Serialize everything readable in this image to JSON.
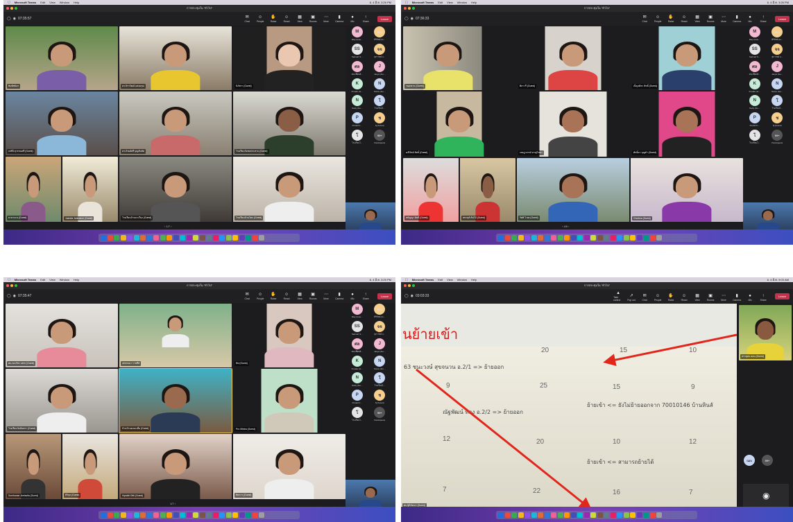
{
  "menubar": {
    "app": "Microsoft Teams",
    "items": [
      "Edit",
      "View",
      "Window",
      "Help"
    ]
  },
  "clocks": [
    "อ. 4 มี.ค. 3:26 PM",
    "อ. 4 มี.ค. 3:25 PM",
    "อ. 4 มี.ค. 9:03 AM"
  ],
  "meeting_title": "การประชุมใน \"ทั่วไป\"",
  "timers": [
    "07:35:57",
    "07:36:33",
    "07:35:47",
    "03:03:33"
  ],
  "toolbar": {
    "chat": "Chat",
    "people": "People",
    "raise": "Raise",
    "react": "React",
    "view": "View",
    "rooms": "Rooms",
    "more": "More",
    "camera": "Camera",
    "mic": "Mic",
    "share": "Share",
    "leave": "Leave",
    "take_control": "Take control",
    "pop_out": "Pop out"
  },
  "shot1": {
    "tiles": [
      "พิมพ์ชนิดา",
      "ดร.จิราวัฒน์ แสงอรุณ",
      "นิภัสรา (Guest)",
      "เกศินี สุวรรณศรี (Guest)",
      "ดร.ภิรมย์ศรี บุญสันทัด",
      "โรงเรียนวัดชลประทาน (Guest)",
      "ดาดาแกง (Guest)",
      "Juenda Juntraeon (Guest)",
      "โรงเรียนบ้านนาเวียง (Guest)",
      "โรงเรียนบ้านโคก (Guest)"
    ],
    "pager": "1/7"
  },
  "shot2": {
    "tiles": [
      "รณุกษาน (Guest)",
      "ศิลาวรี (Guest)",
      "เบ็ญจศิลา สิทธิ์ (Guest)",
      "มณีรัตน์ สิทธิ์ (Guest)",
      "เจษฎาภรณ์ หาญไชยา",
      "ศักดิ์ดา บุญคำ (Guest)",
      "สมัญญา อิทธิ์ (Guest)",
      "สหายุต์ ต้นไม้ (Guest)",
      "รัตติ ไวงย (Guest)",
      "Chutima (Guest)"
    ],
    "pager": "4/6"
  },
  "shot3": {
    "tiles": [
      "ศน.ณรภัชร เพชร (Guest)",
      "เพชรทนา ราชสีห์",
      "ทิพ (Guest)",
      "โรงเรียนวัดสันทรา (Guest)",
      "บ้านบ้านดงมะเดื่อ (Guest)",
      "Pro Mintra (Guest)",
      "Sornkanan Jeetavila (Guest)",
      "สิวิกุล (Guest)",
      "Hysidiri Ditti (Guest)",
      "ทิพวาร (Guest)"
    ],
    "pager": "1/7"
  },
  "shot4": {
    "slide_title": "นย้ายเข้า",
    "row1": "63 ชนะวงษ์ สุขจนวน อ.2/1 => ย้ายออก",
    "row2": "ณัฐพัฒน์ ทอง อ.2/2 => ย้ายออก",
    "row2b": "ย้ายเข้า <= ยังไม่ย้ายออกจาก 70010146 บ้านหินลั",
    "row3": "ย้ายเข้า <= สามารถย้ายได้",
    "nums": [
      "20",
      "15",
      "10",
      "9",
      "25",
      "15",
      "9",
      "12",
      "20",
      "10",
      "12",
      "7",
      "22",
      "16",
      "7"
    ],
    "presenter_label": "ศน.ฐิติวัฒนา (Guest)",
    "speaker_label": "สรายุทธ ดอน (Guest)",
    "avatar_label": "ณเบ",
    "avatar2_label": "99+"
  },
  "sidebar": [
    {
      "i": "M",
      "l": "May (Gue...",
      "c": "#f3b9d0"
    },
    {
      "i": "ทแม",
      "l": "ศิริรัตน์ (G...",
      "c": "#f6cf8f"
    },
    {
      "i": "SS",
      "l": "Sarinart S...",
      "c": "#e4e4e4"
    },
    {
      "i": "จจ",
      "l": "สุภาวัลย์ จ...",
      "c": "#f6cf8f"
    },
    {
      "i": "ศล",
      "l": "ศน.เพื่อนศิ...",
      "c": "#f3b9d0"
    },
    {
      "i": "J",
      "l": "Janya (Gu...",
      "c": "#f3b9d0"
    },
    {
      "i": "K",
      "l": "Kruake (G...",
      "c": "#c6ebd8"
    },
    {
      "i": "N",
      "l": "Namu (Gu...",
      "c": "#c7d6f2"
    },
    {
      "i": "N",
      "l": "Natty (Gu...",
      "c": "#c6ebd8"
    },
    {
      "i": "โ",
      "l": "โรงเรียนไ...",
      "c": "#c7d6f2"
    },
    {
      "i": "P",
      "l": "Pusanit I...",
      "c": "#c7d6f2"
    },
    {
      "i": "ช",
      "l": "ชุ (Guest)",
      "c": "#f6cf8f"
    },
    {
      "i": "โ",
      "l": "โรงเรียนไ...",
      "c": "#e4e4e4"
    },
    {
      "i": "99+",
      "l": "Participants",
      "c": "#555555"
    }
  ]
}
